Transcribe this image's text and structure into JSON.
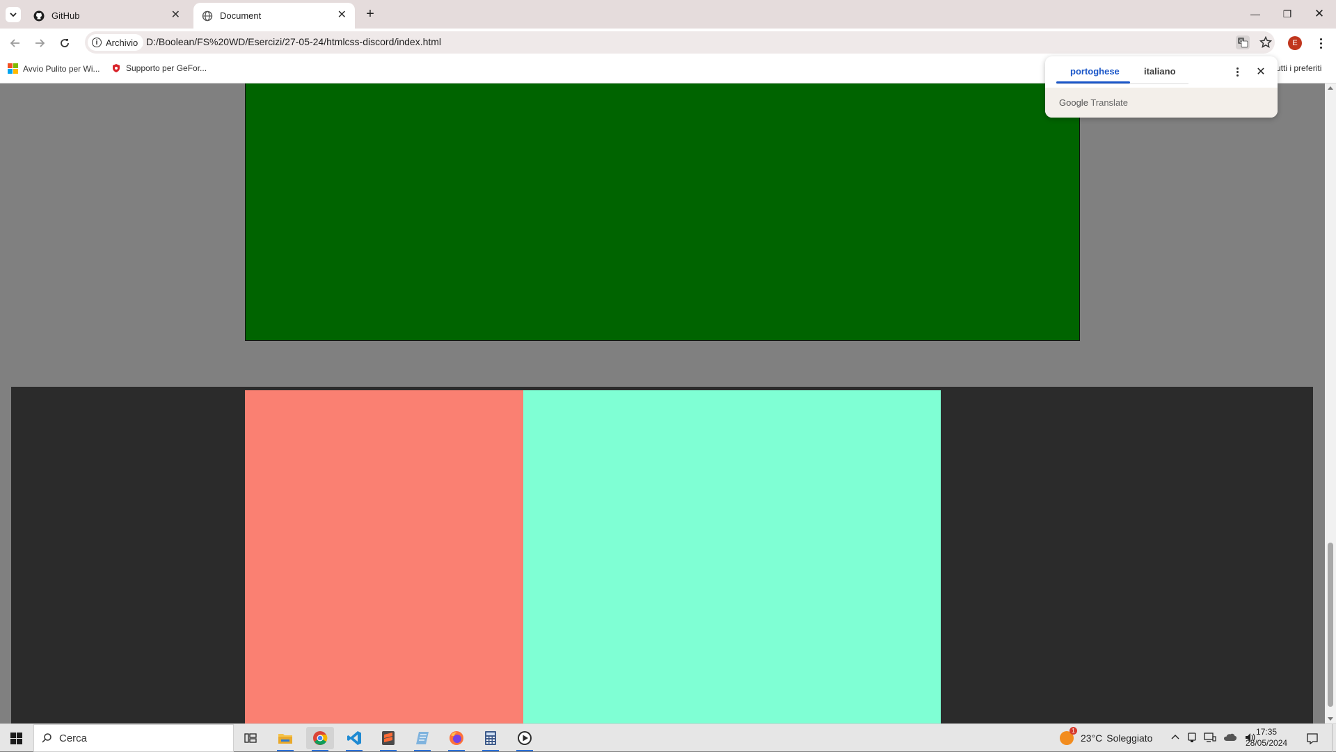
{
  "browser": {
    "tabs": [
      {
        "title": "GitHub",
        "icon": "github-icon",
        "active": false
      },
      {
        "title": "Document",
        "icon": "globe-icon",
        "active": true
      }
    ],
    "tab_list_icon": "chevron-down-icon",
    "new_tab_label": "+",
    "window_controls": {
      "minimize": "—",
      "restore": "❐",
      "close": "✕"
    },
    "address_chip_label": "Archivio",
    "url": "D:/Boolean/FS%20WD/Esercizi/27-05-24/htmlcss-discord/index.html",
    "profile_initial": "E",
    "profile_color": "#c0361d"
  },
  "bookmarks": {
    "items": [
      {
        "label": "Avvio Pulito per Wi...",
        "icon": "windows-logo-icon"
      },
      {
        "label": "Supporto per GeFor...",
        "icon": "shield-icon"
      }
    ],
    "all_bookmarks_label": "utti i preferiti"
  },
  "translate_popup": {
    "source_lang": "portoghese",
    "target_lang": "italiano",
    "footer_brand": "Google",
    "footer_product": "Translate",
    "accent_color": "#1a56c8"
  },
  "page": {
    "background": "#808080",
    "green_box_color": "#006400",
    "dark_band_color": "#2b2b2b",
    "salmon_color": "#fa8072",
    "aqua_color": "#7fffd4"
  },
  "taskbar": {
    "search_placeholder": "Cerca",
    "apps": [
      "task-view-icon",
      "file-explorer-icon",
      "chrome-icon",
      "vscode-icon",
      "sublime-icon",
      "notepad-icon",
      "firefox-icon",
      "calculator-icon",
      "media-player-icon"
    ],
    "weather": {
      "temp": "23°C",
      "condition": "Soleggiato",
      "alert": "1"
    },
    "time": "17:35",
    "date": "28/05/2024"
  }
}
